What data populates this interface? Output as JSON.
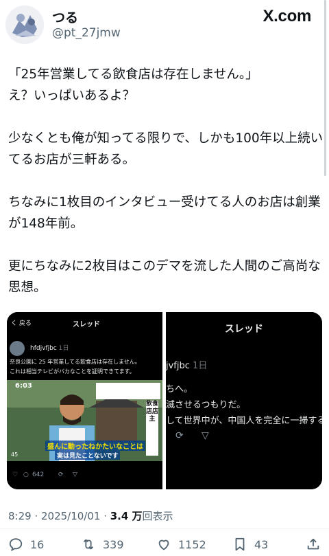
{
  "author": {
    "display_name": "つる",
    "handle": "@pt_27jmw",
    "logo": "X.com"
  },
  "tweet": {
    "text": "「25年営業してる飲食店は存在しません。」\nえ？いっぱいあるよ？\n\n少なくとも俺が知ってる限りで、しかも100年以上続いてるお店が三軒ある。\n\nちなみに1枚目のインタビュー受けてる人のお店は創業が148年前。\n\n更にちなみに2枚目はこのデマを流した人間のご高尚な思想。"
  },
  "media_left": {
    "back_label": "く 戻る",
    "title": "スレッド",
    "user": "hfdjvfjbc",
    "time": "1日",
    "line1": "奈良公園に 25 年営業してる飲食店は存在しません。",
    "line2": "これは相当テレビがバカなことを証明できてます。",
    "tv_time": "6:03",
    "tv_caption1": "盛んに動ったねかたいなことは",
    "tv_caption2": "実は見たことないです",
    "tv_count": "45",
    "tv_side": "飲食店店主",
    "actions": {
      "reply": "642"
    }
  },
  "media_right": {
    "title": "スレッド",
    "user": "jvfjbc",
    "time": "1日",
    "line1": "ちへ。",
    "line2": "滅させるつもりだ。",
    "line3": "して世界中が、中国人を完全に一掃する"
  },
  "meta": {
    "time": "8:29 · 2025/10/01 · ",
    "views": "3.4 万",
    "views_label": "回表示"
  },
  "actions": {
    "reply": "16",
    "retweet": "339",
    "like": "1152",
    "bookmark": "43"
  }
}
